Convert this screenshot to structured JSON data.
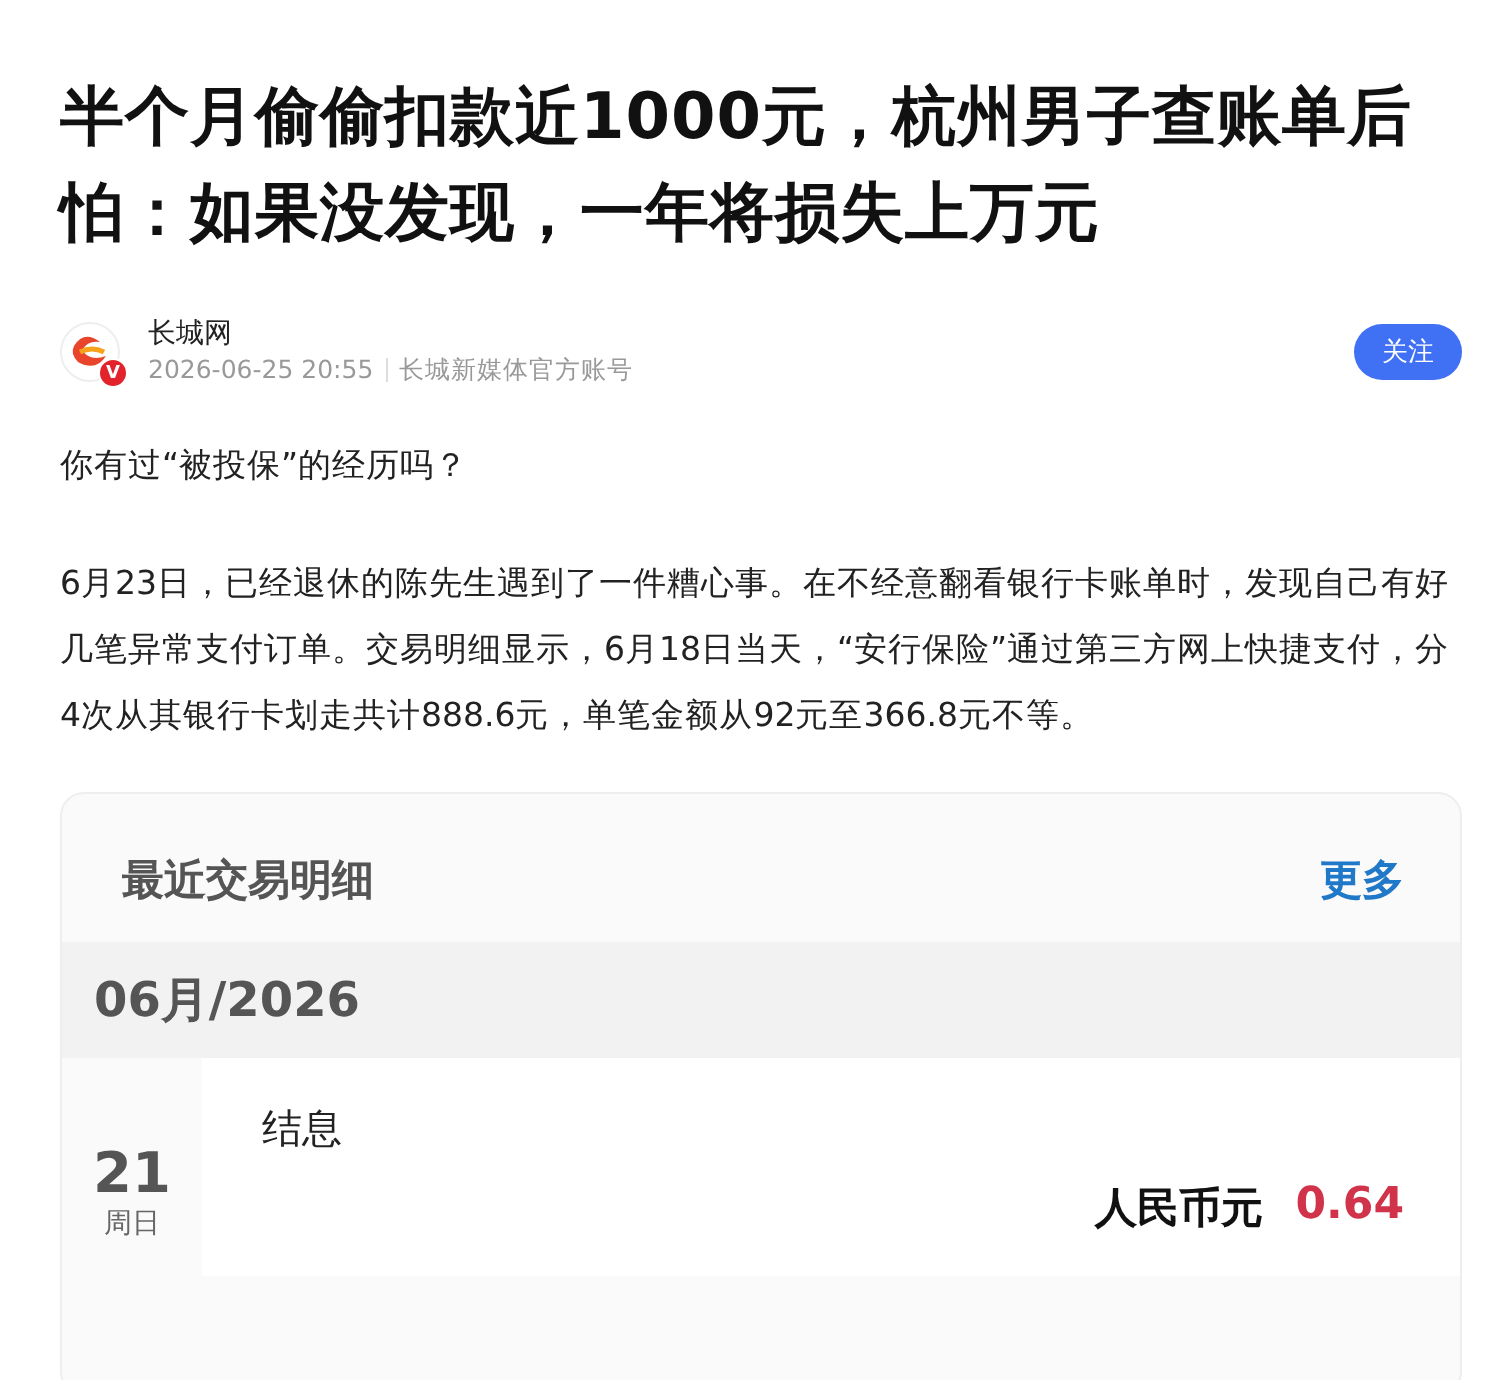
{
  "article": {
    "title": "半个月偷偷扣款近1000元，杭州男子查账单后怕：如果没发现，一年将损失上万元",
    "author": {
      "name": "长城网",
      "time": "2026-06-25 20:55",
      "source": "长城新媒体官方账号",
      "follow_label": "关注",
      "verified_mark": "V"
    },
    "paragraphs": [
      "你有过“被投保”的经历吗？",
      "6月23日，已经退休的陈先生遇到了一件糟心事。在不经意翻看银行卡账单时，发现自己有好几笔异常支付订单。交易明细显示，6月18日当天，“安行保险”通过第三方网上快捷支付，分4次从其银行卡划走共计888.6元，单笔金额从92元至366.8元不等。"
    ],
    "screenshot": {
      "title": "最近交易明细",
      "more_label": "更多",
      "month": "06月/2026",
      "transactions": [
        {
          "day": "21",
          "weekday": "周日",
          "description": "结息",
          "currency": "人民币元",
          "amount": "0.64"
        }
      ]
    }
  }
}
